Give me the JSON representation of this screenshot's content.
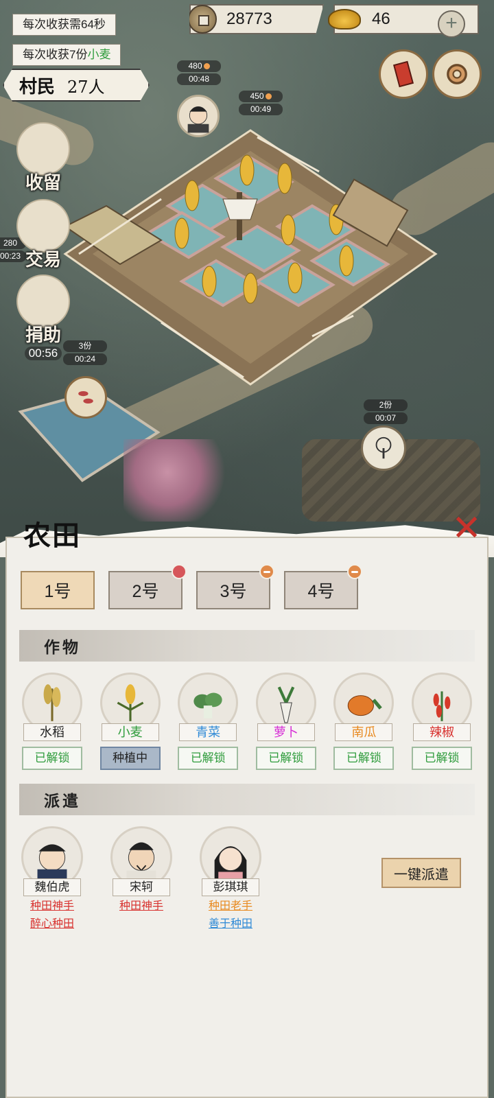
{
  "top": {
    "harvest_time": "每次收获需64秒",
    "harvest_yield_prefix": "每次收获7份",
    "harvest_yield_crop": "小麦",
    "villager_label": "村民",
    "villager_count": "27人",
    "coins": "28773",
    "gold": "46"
  },
  "map_tags": [
    {
      "top": "480",
      "bottom": "00:48"
    },
    {
      "top": "450",
      "bottom": "00:49"
    },
    {
      "top": "280",
      "bottom": "00:23"
    },
    {
      "top": "3份",
      "bottom": "00:24"
    },
    {
      "top": "2份",
      "bottom": "00:07"
    }
  ],
  "side_actions": {
    "retain": {
      "label": "收留"
    },
    "trade": {
      "label": "交易"
    },
    "donate": {
      "label": "捐助",
      "timer": "00:56"
    }
  },
  "panel": {
    "title": "农田",
    "tabs": [
      {
        "label": "1号",
        "active": true
      },
      {
        "label": "2号",
        "badge": "red"
      },
      {
        "label": "3号",
        "badge": "orange"
      },
      {
        "label": "4号",
        "badge": "orange"
      }
    ],
    "crops_header": "作物",
    "crops": [
      {
        "name": "水稻",
        "status": "已解锁",
        "color": "#222222",
        "icon": "rice-icon"
      },
      {
        "name": "小麦",
        "status": "种植中",
        "color": "#2f9c3c",
        "icon": "wheat-icon"
      },
      {
        "name": "青菜",
        "status": "已解锁",
        "color": "#2f8ad6",
        "icon": "greens-icon"
      },
      {
        "name": "萝卜",
        "status": "已解锁",
        "color": "#d62fd6",
        "icon": "radish-icon"
      },
      {
        "name": "南瓜",
        "status": "已解锁",
        "color": "#e88a20",
        "icon": "pumpkin-icon"
      },
      {
        "name": "辣椒",
        "status": "已解锁",
        "color": "#d8322f",
        "icon": "chili-icon"
      }
    ],
    "dispatch_header": "派遣",
    "workers": [
      {
        "name": "魏伯虎",
        "traits": [
          "种田神手",
          "醉心种田"
        ]
      },
      {
        "name": "宋轲",
        "traits": [
          "种田神手"
        ]
      },
      {
        "name": "彭琪琪",
        "traits": [
          "种田老手",
          "善于种田"
        ]
      }
    ],
    "dispatch_all": "一键派遣"
  }
}
